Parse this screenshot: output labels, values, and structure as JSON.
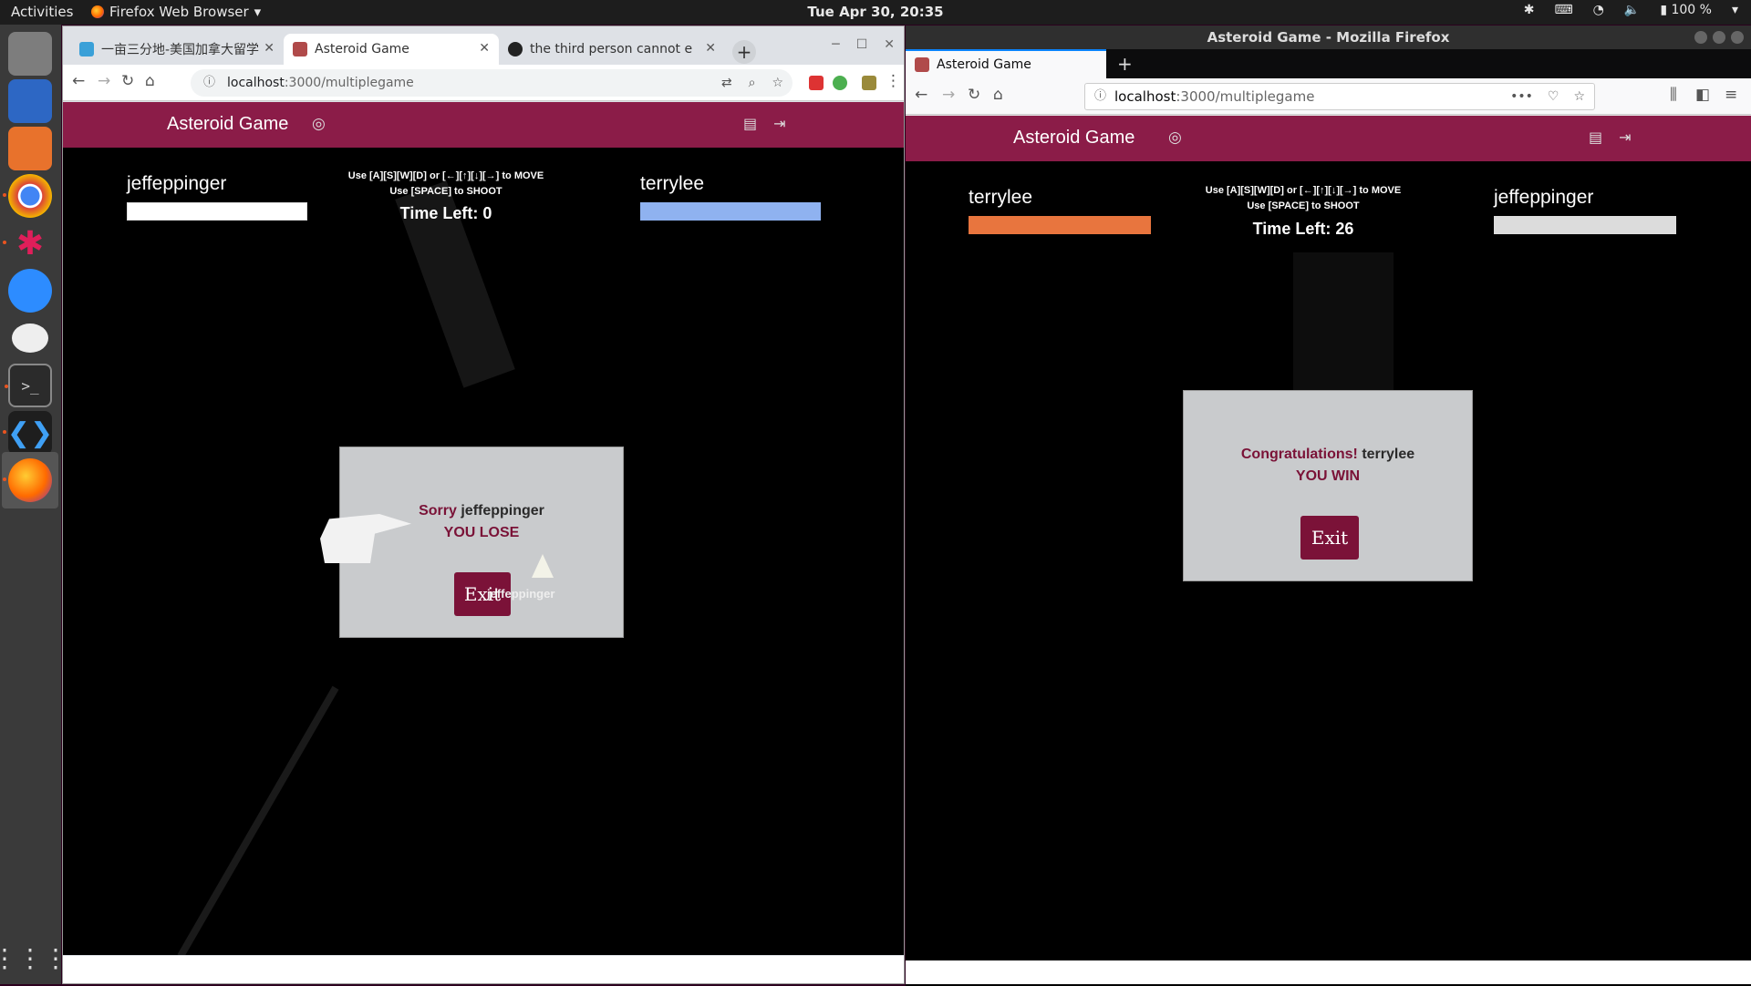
{
  "topbar": {
    "activities": "Activities",
    "app_name": "Firefox Web Browser",
    "clock": "Tue Apr 30, 20:35",
    "battery": "100 %"
  },
  "chrome": {
    "tabs": [
      {
        "label": "一亩三分地-美国加拿大留学"
      },
      {
        "label": "Asteroid Game"
      },
      {
        "label": "the third person cannot e"
      }
    ],
    "url_host": "localhost",
    "url_path": ":3000/multiplegame"
  },
  "firefox": {
    "window_title": "Asteroid Game - Mozilla Firefox",
    "tab_label": "Asteroid Game",
    "url_host": "localhost",
    "url_path": ":3000/multiplegame"
  },
  "game_left": {
    "brand": "Asteroid Game",
    "player1": "jeffeppinger",
    "player2": "terrylee",
    "hint_move": "Use [A][S][W][D] or [←][↑][↓][→] to MOVE",
    "hint_shoot": "Use [SPACE] to SHOOT",
    "time_left": "Time Left: 0",
    "p1_color": "#ffffff",
    "p2_color": "#8fb2f0",
    "modal_prefix": "Sorry",
    "modal_name": "jeffeppinger",
    "modal_result": "YOU LOSE",
    "exit": "Exit",
    "ship_label": "jeffeppinger"
  },
  "game_right": {
    "brand": "Asteroid Game",
    "player1": "terrylee",
    "player2": "jeffeppinger",
    "hint_move": "Use [A][S][W][D] or [←][↑][↓][→] to MOVE",
    "hint_shoot": "Use [SPACE] to SHOOT",
    "time_left": "Time Left: 26",
    "p1_color": "#e8753e",
    "p2_color": "#dcdcdc",
    "modal_prefix": "Congratulations!",
    "modal_name": "terrylee",
    "modal_result": "YOU WIN",
    "exit": "Exit"
  }
}
